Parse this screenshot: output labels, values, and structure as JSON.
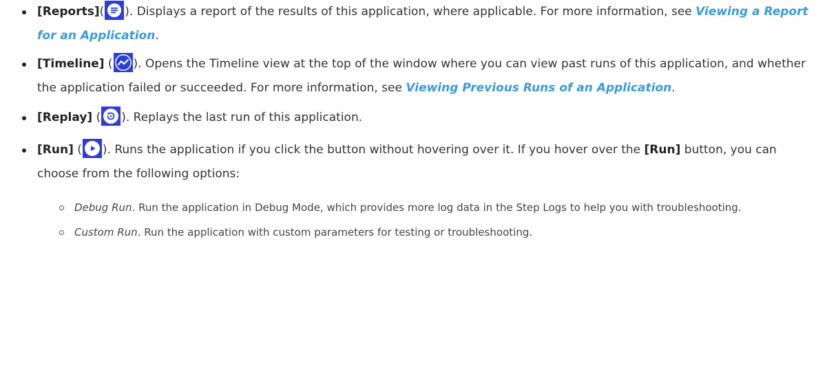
{
  "items": [
    {
      "id": "reports",
      "label": "[Reports]",
      "open_paren": "(",
      "icon": "reports-icon",
      "close_text": "). Displays a report of the results of this application, where applicable. For more information, see ",
      "link": "Viewing a Report for an Application",
      "end": "."
    },
    {
      "id": "timeline",
      "label": "[Timeline]",
      "open_paren": " (",
      "icon": "timeline-icon",
      "close_text": "). Opens the Timeline view at the top of the window where you can view past runs of this application, and whether the application failed or succeeded. For more information, see ",
      "link": "Viewing Previous Runs of an Application",
      "end": "."
    },
    {
      "id": "replay",
      "label": "[Replay]",
      "open_paren": " (",
      "icon": "replay-icon",
      "close_text": "). Replays the last run of this application."
    },
    {
      "id": "run",
      "label": "[Run]",
      "open_paren": " (",
      "icon": "run-icon",
      "close_text": "). Runs the application if you click the button without hovering over it. If you hover over the ",
      "label2": "[Run]",
      "close_text2": " button, you can choose from the following options:"
    }
  ],
  "subitems": [
    {
      "label": "Debug Run",
      "text": ". Run the application in Debug Mode, which provides more log data in the Step Logs to help you with troubleshooting."
    },
    {
      "label": "Custom Run",
      "text": ". Run the application with custom parameters for testing or troubleshooting."
    }
  ],
  "colors": {
    "icon_bg": "#2b3ed8",
    "icon_fg": "#ffffff",
    "link": "#3a9ad9"
  }
}
